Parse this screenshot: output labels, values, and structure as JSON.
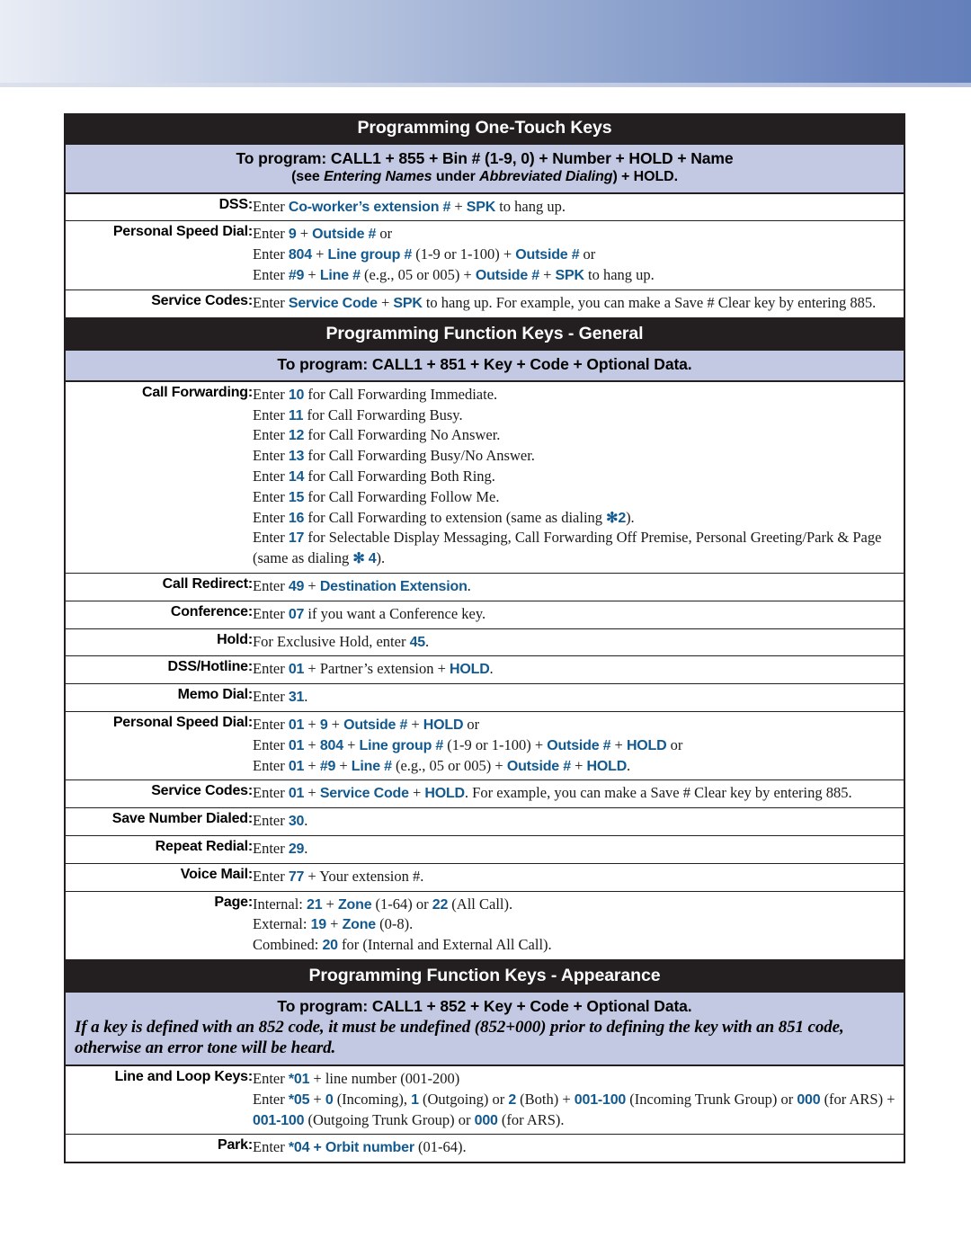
{
  "colors": {
    "header_bar": "#231F20",
    "subheader_bar": "#C3C8E3",
    "accent_blue": "#12598F",
    "banner_gradient_start": "#E9EDF5",
    "banner_gradient_end": "#6480BB",
    "page_background": "#FFFFFF"
  },
  "sections": [
    {
      "title": "Programming One-Touch Keys",
      "subheader_line1": "To program: CALL1 + 855 + Bin # (1-9, 0) + Number + HOLD + Name",
      "subheader_line2_parts": [
        {
          "text": "(see ",
          "style": "bold"
        },
        {
          "text": "Entering Names",
          "style": "bold-italic"
        },
        {
          "text": " under ",
          "style": "bold"
        },
        {
          "text": "Abbreviated Dialing",
          "style": "bold-italic"
        },
        {
          "text": ") + HOLD.",
          "style": "bold"
        }
      ],
      "rows": [
        {
          "label": "DSS:",
          "lines": [
            [
              {
                "t": "Enter ",
                "s": "plain"
              },
              {
                "t": "Co-worker’s extension #",
                "s": "key"
              },
              {
                "t": " + ",
                "s": "plain"
              },
              {
                "t": "SPK",
                "s": "key"
              },
              {
                "t": " to hang up.",
                "s": "plain"
              }
            ]
          ]
        },
        {
          "label": "Personal Speed Dial:",
          "lines": [
            [
              {
                "t": "Enter ",
                "s": "plain"
              },
              {
                "t": "9",
                "s": "key"
              },
              {
                "t": " + ",
                "s": "plain"
              },
              {
                "t": "Outside #",
                "s": "key"
              },
              {
                "t": " or",
                "s": "plain"
              }
            ],
            [
              {
                "t": "Enter ",
                "s": "plain"
              },
              {
                "t": "804",
                "s": "key"
              },
              {
                "t": " + ",
                "s": "plain"
              },
              {
                "t": "Line group #",
                "s": "key"
              },
              {
                "t": " (1-9 or 1-100) + ",
                "s": "plain"
              },
              {
                "t": "Outside #",
                "s": "key"
              },
              {
                "t": " or",
                "s": "plain"
              }
            ],
            [
              {
                "t": "Enter ",
                "s": "plain"
              },
              {
                "t": "#9",
                "s": "key"
              },
              {
                "t": " + ",
                "s": "plain"
              },
              {
                "t": "Line #",
                "s": "key"
              },
              {
                "t": " (e.g., 05 or 005) + ",
                "s": "plain"
              },
              {
                "t": "Outside #",
                "s": "key"
              },
              {
                "t": " + ",
                "s": "plain"
              },
              {
                "t": "SPK",
                "s": "key"
              },
              {
                "t": " to hang up.",
                "s": "plain"
              }
            ]
          ]
        },
        {
          "label": "Service Codes:",
          "lines": [
            [
              {
                "t": "Enter ",
                "s": "plain"
              },
              {
                "t": "Service Code",
                "s": "key"
              },
              {
                "t": " + ",
                "s": "plain"
              },
              {
                "t": "SPK",
                "s": "key"
              },
              {
                "t": " to hang up. For example, you can make a Save # Clear key by entering 885.",
                "s": "plain"
              }
            ]
          ]
        }
      ]
    },
    {
      "title": "Programming Function Keys - General",
      "subheader_line1": "To program: CALL1 + 851 + Key + Code + Optional Data.",
      "subheader_line2_parts": [],
      "rows": [
        {
          "label": "Call Forwarding:",
          "lines": [
            [
              {
                "t": "Enter ",
                "s": "plain"
              },
              {
                "t": "10",
                "s": "key"
              },
              {
                "t": " for Call Forwarding Immediate.",
                "s": "plain"
              }
            ],
            [
              {
                "t": "Enter ",
                "s": "plain"
              },
              {
                "t": "11",
                "s": "key"
              },
              {
                "t": " for Call Forwarding Busy.",
                "s": "plain"
              }
            ],
            [
              {
                "t": "Enter ",
                "s": "plain"
              },
              {
                "t": "12",
                "s": "key"
              },
              {
                "t": " for Call Forwarding No Answer.",
                "s": "plain"
              }
            ],
            [
              {
                "t": "Enter ",
                "s": "plain"
              },
              {
                "t": "13",
                "s": "key"
              },
              {
                "t": " for Call Forwarding Busy/No Answer.",
                "s": "plain"
              }
            ],
            [
              {
                "t": "Enter ",
                "s": "plain"
              },
              {
                "t": "14",
                "s": "key"
              },
              {
                "t": " for Call Forwarding Both Ring.",
                "s": "plain"
              }
            ],
            [
              {
                "t": "Enter ",
                "s": "plain"
              },
              {
                "t": "15",
                "s": "key"
              },
              {
                "t": " for Call Forwarding Follow Me.",
                "s": "plain"
              }
            ],
            [
              {
                "t": "Enter ",
                "s": "plain"
              },
              {
                "t": "16",
                "s": "key"
              },
              {
                "t": " for Call Forwarding to extension (same as dialing ",
                "s": "plain"
              },
              {
                "t": "✻2",
                "s": "key"
              },
              {
                "t": ").",
                "s": "plain"
              }
            ],
            [
              {
                "t": "Enter ",
                "s": "plain"
              },
              {
                "t": "17",
                "s": "key"
              },
              {
                "t": " for Selectable Display Messaging, Call Forwarding Off Premise, Personal Greeting/Park & Page (same as dialing ",
                "s": "plain"
              },
              {
                "t": "✻ 4",
                "s": "key"
              },
              {
                "t": ").",
                "s": "plain"
              }
            ]
          ]
        },
        {
          "label": "Call Redirect:",
          "lines": [
            [
              {
                "t": "Enter ",
                "s": "plain"
              },
              {
                "t": "49",
                "s": "key"
              },
              {
                "t": " + ",
                "s": "plain"
              },
              {
                "t": "Destination Extension",
                "s": "key"
              },
              {
                "t": ".",
                "s": "plain"
              }
            ]
          ]
        },
        {
          "label": "Conference:",
          "lines": [
            [
              {
                "t": "Enter ",
                "s": "plain"
              },
              {
                "t": "07",
                "s": "key"
              },
              {
                "t": " if you want a Conference key.",
                "s": "plain"
              }
            ]
          ]
        },
        {
          "label": "Hold:",
          "lines": [
            [
              {
                "t": "For Exclusive Hold, enter ",
                "s": "plain"
              },
              {
                "t": "45",
                "s": "key"
              },
              {
                "t": ".",
                "s": "plain"
              }
            ]
          ]
        },
        {
          "label": "DSS/Hotline:",
          "lines": [
            [
              {
                "t": "Enter ",
                "s": "plain"
              },
              {
                "t": "01",
                "s": "key"
              },
              {
                "t": " + Partner’s extension + ",
                "s": "plain"
              },
              {
                "t": "HOLD",
                "s": "key"
              },
              {
                "t": ".",
                "s": "plain"
              }
            ]
          ]
        },
        {
          "label": "Memo Dial:",
          "lines": [
            [
              {
                "t": "Enter ",
                "s": "plain"
              },
              {
                "t": "31",
                "s": "key"
              },
              {
                "t": ".",
                "s": "plain"
              }
            ]
          ]
        },
        {
          "label": "Personal Speed Dial:",
          "lines": [
            [
              {
                "t": "Enter ",
                "s": "plain"
              },
              {
                "t": "01",
                "s": "key"
              },
              {
                "t": " + ",
                "s": "plain"
              },
              {
                "t": "9",
                "s": "key"
              },
              {
                "t": " + ",
                "s": "plain"
              },
              {
                "t": "Outside #",
                "s": "key"
              },
              {
                "t": " + ",
                "s": "plain"
              },
              {
                "t": "HOLD",
                "s": "key"
              },
              {
                "t": " or",
                "s": "plain"
              }
            ],
            [
              {
                "t": "Enter ",
                "s": "plain"
              },
              {
                "t": "01",
                "s": "key"
              },
              {
                "t": " + ",
                "s": "plain"
              },
              {
                "t": "804",
                "s": "key"
              },
              {
                "t": " + ",
                "s": "plain"
              },
              {
                "t": "Line group #",
                "s": "key"
              },
              {
                "t": " (1-9 or 1-100) + ",
                "s": "plain"
              },
              {
                "t": "Outside #",
                "s": "key"
              },
              {
                "t": " + ",
                "s": "plain"
              },
              {
                "t": "HOLD",
                "s": "key"
              },
              {
                "t": " or",
                "s": "plain"
              }
            ],
            [
              {
                "t": "Enter ",
                "s": "plain"
              },
              {
                "t": "01",
                "s": "key"
              },
              {
                "t": " + ",
                "s": "plain"
              },
              {
                "t": "#9",
                "s": "key"
              },
              {
                "t": " + ",
                "s": "plain"
              },
              {
                "t": "Line #",
                "s": "key"
              },
              {
                "t": " (e.g., 05 or 005) + ",
                "s": "plain"
              },
              {
                "t": "Outside #",
                "s": "key"
              },
              {
                "t": " + ",
                "s": "plain"
              },
              {
                "t": "HOLD",
                "s": "key"
              },
              {
                "t": ".",
                "s": "plain"
              }
            ]
          ]
        },
        {
          "label": "Service Codes:",
          "lines": [
            [
              {
                "t": "Enter ",
                "s": "plain"
              },
              {
                "t": "01",
                "s": "key"
              },
              {
                "t": " + ",
                "s": "plain"
              },
              {
                "t": "Service Code",
                "s": "key"
              },
              {
                "t": " + ",
                "s": "plain"
              },
              {
                "t": "HOLD",
                "s": "key"
              },
              {
                "t": ". For example, you can make a Save # Clear key by entering 885.",
                "s": "plain"
              }
            ]
          ]
        },
        {
          "label": "Save Number Dialed:",
          "lines": [
            [
              {
                "t": "Enter ",
                "s": "plain"
              },
              {
                "t": "30",
                "s": "key"
              },
              {
                "t": ".",
                "s": "plain"
              }
            ]
          ]
        },
        {
          "label": "Repeat Redial:",
          "lines": [
            [
              {
                "t": "Enter ",
                "s": "plain"
              },
              {
                "t": "29",
                "s": "key"
              },
              {
                "t": ".",
                "s": "plain"
              }
            ]
          ]
        },
        {
          "label": "Voice Mail:",
          "lines": [
            [
              {
                "t": "Enter ",
                "s": "plain"
              },
              {
                "t": "77",
                "s": "key"
              },
              {
                "t": " + Your extension #.",
                "s": "plain"
              }
            ]
          ]
        },
        {
          "label": "Page:",
          "lines": [
            [
              {
                "t": "Internal: ",
                "s": "plain"
              },
              {
                "t": "21",
                "s": "key"
              },
              {
                "t": " + ",
                "s": "plain"
              },
              {
                "t": "Zone",
                "s": "key"
              },
              {
                "t": " (1-64) or ",
                "s": "plain"
              },
              {
                "t": "22",
                "s": "key"
              },
              {
                "t": " (All Call).",
                "s": "plain"
              }
            ],
            [
              {
                "t": "External: ",
                "s": "plain"
              },
              {
                "t": "19",
                "s": "key"
              },
              {
                "t": " + ",
                "s": "plain"
              },
              {
                "t": "Zone",
                "s": "key"
              },
              {
                "t": " (0-8).",
                "s": "plain"
              }
            ],
            [
              {
                "t": "Combined: ",
                "s": "plain"
              },
              {
                "t": "20",
                "s": "key"
              },
              {
                "t": " for (Internal and External All Call).",
                "s": "plain"
              }
            ]
          ]
        }
      ]
    },
    {
      "title": "Programming Function Keys - Appearance",
      "subheader_line1": "To program: CALL1 + 852 + Key + Code + Optional Data.",
      "subheader_warning": "If a key is defined with an 852 code, it must be undefined (852+000) prior to defining the key with an 851 code, otherwise an error tone will be heard.",
      "subheader_line2_parts": [],
      "rows": [
        {
          "label": "Line and Loop Keys:",
          "lines": [
            [
              {
                "t": "Enter ",
                "s": "plain"
              },
              {
                "t": "*01",
                "s": "key"
              },
              {
                "t": " + line number (001-200)",
                "s": "plain"
              }
            ],
            [
              {
                "t": "Enter ",
                "s": "plain"
              },
              {
                "t": "*05",
                "s": "key"
              },
              {
                "t": " + ",
                "s": "plain"
              },
              {
                "t": "0",
                "s": "key"
              },
              {
                "t": " (Incoming), ",
                "s": "plain"
              },
              {
                "t": "1",
                "s": "key"
              },
              {
                "t": " (Outgoing) or ",
                "s": "plain"
              },
              {
                "t": "2",
                "s": "key"
              },
              {
                "t": " (Both) + ",
                "s": "plain"
              },
              {
                "t": "001-100",
                "s": "key"
              },
              {
                "t": " (Incoming Trunk Group) or ",
                "s": "plain"
              },
              {
                "t": "000",
                "s": "key"
              },
              {
                "t": " (for ARS) + ",
                "s": "plain"
              },
              {
                "t": "001-100",
                "s": "key"
              },
              {
                "t": " (Outgoing Trunk Group) or ",
                "s": "plain"
              },
              {
                "t": "000",
                "s": "key"
              },
              {
                "t": " (for ARS).",
                "s": "plain"
              }
            ]
          ]
        },
        {
          "label": "Park:",
          "lines": [
            [
              {
                "t": "Enter ",
                "s": "plain"
              },
              {
                "t": "*04 + Orbit number",
                "s": "key"
              },
              {
                "t": " (01-64).",
                "s": "plain"
              }
            ]
          ]
        }
      ]
    }
  ]
}
